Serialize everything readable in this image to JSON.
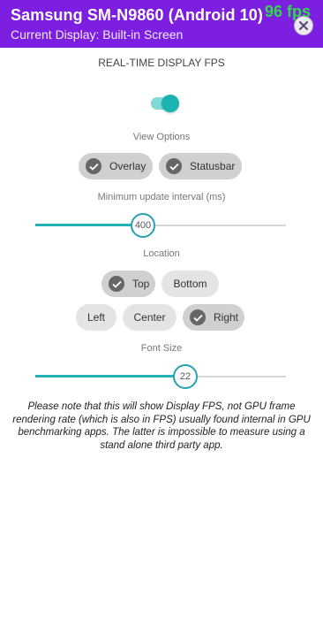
{
  "header": {
    "title": "Samsung SM-N9860 (Android 10)",
    "subtitle": "Current Display: Built-in Screen",
    "fps_overlay": "96 fps",
    "close_icon": "close-icon",
    "bg_color": "#7c1fe0"
  },
  "main": {
    "heading": "REAL-TIME DISPLAY FPS",
    "toggle": {
      "on": true,
      "color": "#1ab3b0"
    },
    "view_options": {
      "label": "View Options",
      "chips": [
        {
          "label": "Overlay",
          "selected": true
        },
        {
          "label": "Statusbar",
          "selected": true
        }
      ]
    },
    "update_interval": {
      "label": "Minimum update interval (ms)",
      "value": "400",
      "fraction": 0.43
    },
    "location": {
      "label": "Location",
      "row1": [
        {
          "label": "Top",
          "selected": true
        },
        {
          "label": "Bottom",
          "selected": false
        }
      ],
      "row2": [
        {
          "label": "Left",
          "selected": false
        },
        {
          "label": "Center",
          "selected": false
        },
        {
          "label": "Right",
          "selected": true
        }
      ]
    },
    "font_size": {
      "label": "Font Size",
      "value": "22",
      "fraction": 0.6
    },
    "note": "Please note that this will show Display FPS, not GPU frame rendering rate (which is also in FPS) usually found internal in GPU benchmarking apps. The latter is impossible to measure using a stand alone third party app."
  }
}
